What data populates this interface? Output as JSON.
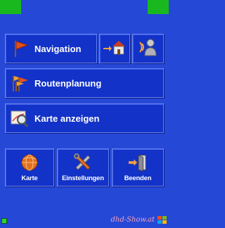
{
  "menu": {
    "navigation": {
      "label": "Navigation",
      "icon": "flag-icon"
    },
    "home": {
      "icon": "home-icon"
    },
    "voice": {
      "icon": "speaker-person-icon"
    },
    "route_planning": {
      "label": "Routenplanung",
      "icon": "checkered-flags-icon"
    },
    "show_map": {
      "label": "Karte anzeigen",
      "icon": "map-magnifier-icon"
    }
  },
  "bottom": {
    "map": {
      "label": "Karte",
      "icon": "globe-icon"
    },
    "settings": {
      "label": "Einstellungen",
      "icon": "tools-icon"
    },
    "exit": {
      "label": "Beenden",
      "icon": "exit-door-icon"
    }
  },
  "status": {
    "watermark": "dhd-Show.at"
  },
  "colors": {
    "background": "#2648d6",
    "button": "#1232c8",
    "corner": "#19b81e"
  }
}
